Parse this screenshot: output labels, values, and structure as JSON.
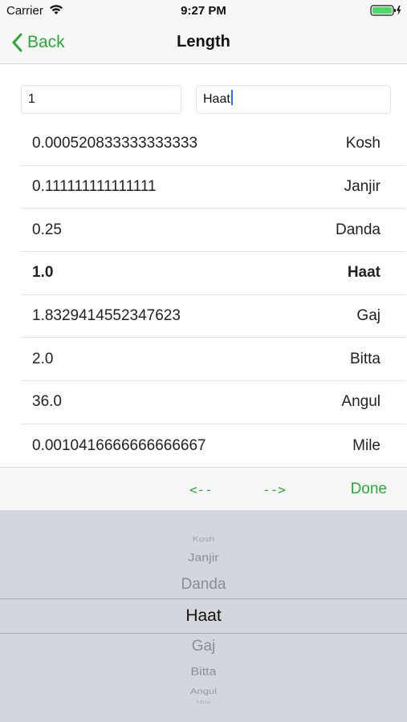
{
  "status": {
    "carrier": "Carrier",
    "time": "9:27 PM"
  },
  "nav": {
    "back_label": "Back",
    "title": "Length"
  },
  "inputs": {
    "value": "1",
    "unit": "Haat"
  },
  "results": [
    {
      "value": "0.000520833333333333",
      "unit": "Kosh",
      "selected": false
    },
    {
      "value": "0.111111111111111",
      "unit": "Janjir",
      "selected": false
    },
    {
      "value": "0.25",
      "unit": "Danda",
      "selected": false
    },
    {
      "value": "1.0",
      "unit": "Haat",
      "selected": true
    },
    {
      "value": "1.8329414552347623",
      "unit": "Gaj",
      "selected": false
    },
    {
      "value": "2.0",
      "unit": "Bitta",
      "selected": false
    },
    {
      "value": "36.0",
      "unit": "Angul",
      "selected": false
    },
    {
      "value": "0.0010416666666666667",
      "unit": "Mile",
      "selected": false
    }
  ],
  "toolbar": {
    "prev_label": "<--",
    "next_label": "-->",
    "done_label": "Done"
  },
  "picker": {
    "items": [
      "Kosh",
      "Janjir",
      "Danda",
      "Haat",
      "Gaj",
      "Bitta",
      "Angul",
      "Mile"
    ],
    "selected": "Haat"
  },
  "colors": {
    "accent": "#2aa83a",
    "picker_bg": "#d3d6dc"
  }
}
